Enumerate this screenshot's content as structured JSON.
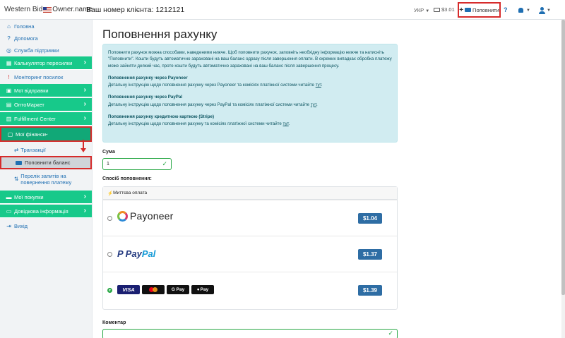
{
  "header": {
    "brand_left": "Western Bid",
    "brand_right": "Owner.name",
    "client_number": "Ваш номер клієнта: 1212121",
    "language": "УКР",
    "balance": "$3.01",
    "topup_label": "Поповнити",
    "help": "?"
  },
  "sidebar": {
    "items": [
      {
        "label": "Головна",
        "icon": "home-icon"
      },
      {
        "label": "Допомога",
        "icon": "question-icon"
      },
      {
        "label": "Служба підтримки",
        "icon": "support-icon"
      },
      {
        "label": "Калькулятор пересилки",
        "icon": "calculator-icon"
      },
      {
        "label": "Моніторинг посилок",
        "icon": "alert-icon"
      },
      {
        "label": "Мої відправки",
        "icon": "box-icon"
      },
      {
        "label": "ОптоМаркет",
        "icon": "market-icon"
      },
      {
        "label": "Fulfillment Center",
        "icon": "warehouse-icon"
      },
      {
        "label": "Мої фінанси",
        "icon": "finance-icon"
      },
      {
        "label": "Транзакції",
        "icon": "exchange-icon"
      },
      {
        "label": "Поповнити баланс",
        "icon": "card-icon"
      },
      {
        "label": "Перелік запитів на повернення платежу",
        "icon": "refund-icon"
      },
      {
        "label": "Мої покупки",
        "icon": "cart-icon"
      },
      {
        "label": "Довідкова інформація",
        "icon": "info-icon"
      },
      {
        "label": "Вихід",
        "icon": "logout-icon"
      }
    ]
  },
  "main": {
    "title": "Поповнення рахунку",
    "intro": "Поповнити рахунок можна способами, наведеними нижче. Щоб поповнити рахунок, заповніть необхідну інформацію нижче та натисніть \"Поповнити\". Кошти будуть автоматично зараховані на ваш баланс одразу після завершення оплати. В окремих випадках обробка платежу може зайняти деякий час, проте кошти будуть автоматично зараховані на ваш баланс після завершення процесу.",
    "sections": [
      {
        "title": "Поповнення рахунку через Payoneer",
        "text": "Детальну інструкцію щодо поповнення рахунку через Payoneer та комісіях платіжної системи читайте",
        "link": "тут"
      },
      {
        "title": "Поповнення рахунку через PayPal",
        "text": "Детальну інструкцію щодо поповнення рахунку через PayPal та комісіях платіжної системи читайте",
        "link": "тут"
      },
      {
        "title": "Поповнення рахунку кредитною карткою (Stripe)",
        "text": "Детальну інструкцію щодо поповнення рахунку та комісіях платіжної системи читайте",
        "link": "тут"
      }
    ],
    "amount_label": "Сума",
    "amount_value": "1",
    "method_label": "Спосіб поповнення:",
    "instant_label": "Миттєва оплата",
    "methods": [
      {
        "name": "Payoneer",
        "price": "$1.04",
        "selected": false
      },
      {
        "name": "PayPal",
        "price": "$1.37",
        "selected": false
      },
      {
        "name": "cards",
        "price": "$1.39",
        "selected": true,
        "cards": [
          "VISA",
          "G Pay",
          "Pay"
        ]
      }
    ],
    "paypal_part1": "Pay",
    "paypal_part2": "Pal",
    "comment_label": "Коментар"
  },
  "colors": {
    "accent_green": "#17c98a",
    "highlight_red": "#d62b2b",
    "price_blue": "#2e6da4",
    "info_bg": "#d1ecf1"
  }
}
